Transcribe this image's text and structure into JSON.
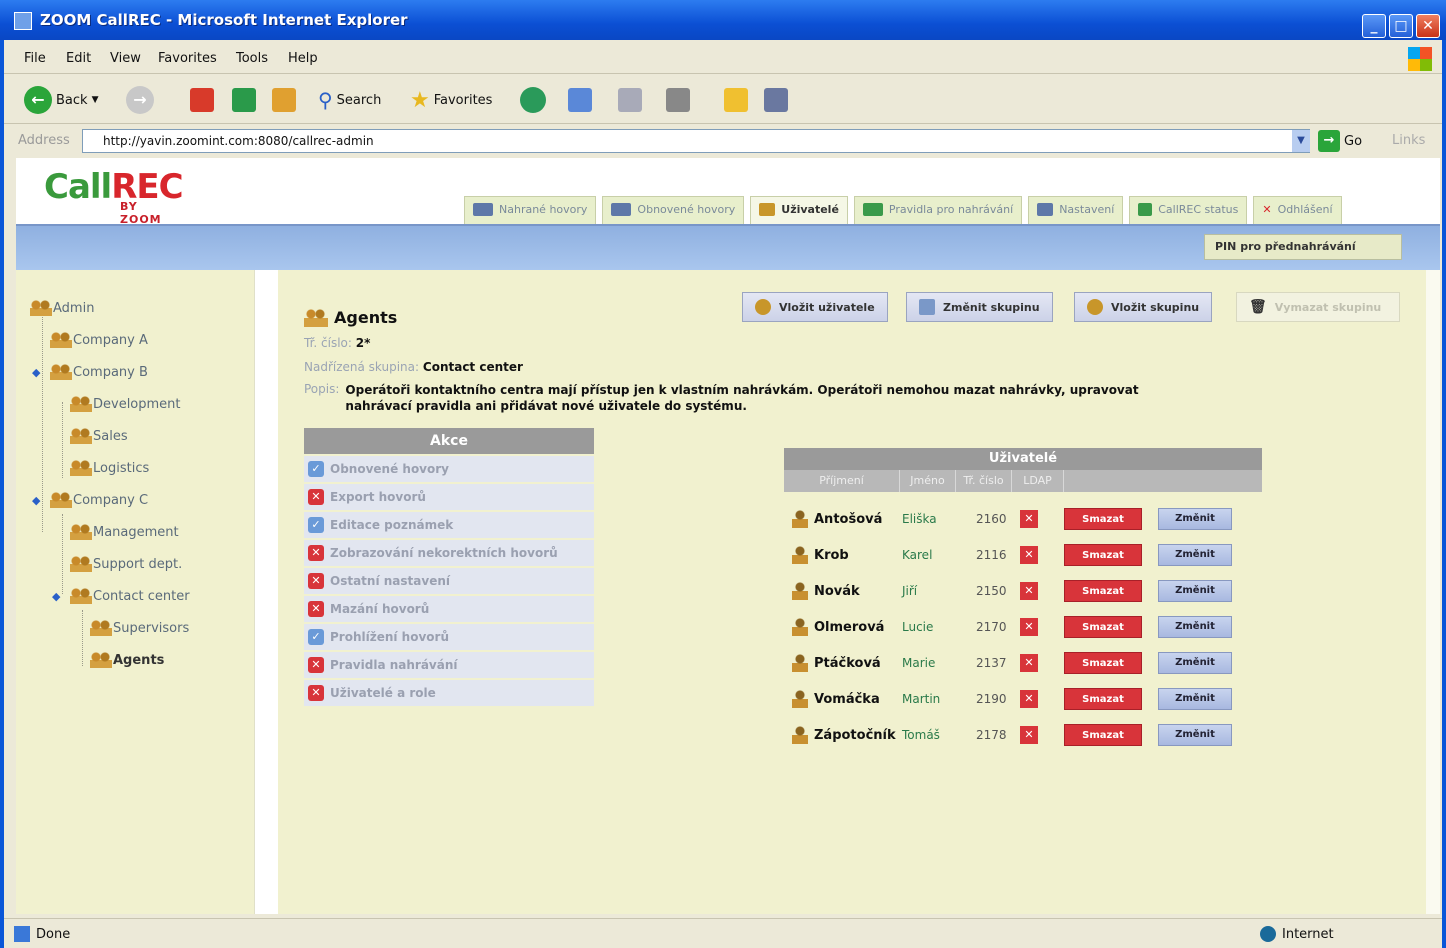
{
  "window": {
    "title": "ZOOM CallREC - Microsoft Internet Explorer"
  },
  "menu": [
    "File",
    "Edit",
    "View",
    "Favorites",
    "Tools",
    "Help"
  ],
  "toolbar": {
    "back": "Back",
    "search": "Search",
    "favorites": "Favorites"
  },
  "address": {
    "label": "Address",
    "url": "http://yavin.zoomint.com:8080/callrec-admin",
    "go": "Go",
    "links": "Links"
  },
  "logo": {
    "main_a": "Call",
    "main_b": "REC",
    "sub": "BY ZOOM"
  },
  "tabs": [
    "Nahrané hovory",
    "Obnovené hovory",
    "Uživatelé",
    "Pravidla pro nahrávání",
    "Nastavení",
    "CallREC status",
    "Odhlášení"
  ],
  "pin_button": "PIN pro přednahrávání",
  "tree": {
    "root": "Admin",
    "company_a": "Company A",
    "company_b": "Company B",
    "development": "Development",
    "sales": "Sales",
    "logistics": "Logistics",
    "company_c": "Company C",
    "management": "Management",
    "support": "Support dept.",
    "contact_center": "Contact center",
    "supervisors": "Supervisors",
    "agents": "Agents"
  },
  "actions": {
    "insert_user": "Vložit uživatele",
    "change_group": "Změnit skupinu",
    "insert_group": "Vložit skupinu",
    "delete_group": "Vymazat skupinu"
  },
  "group": {
    "name": "Agents",
    "ext_label": "Tř. číslo:",
    "ext_value": "2*",
    "parent_label": "Nadřízená skupina:",
    "parent_value": "Contact center",
    "desc_label": "Popis:",
    "desc_value": "Operátoři kontaktního centra mají přístup jen k vlastním nahrávkám. Operátoři nemohou mazat nahrávky, upravovat nahrávací pravidla ani přidávat nové uživatele do systému."
  },
  "akce": {
    "header": "Akce",
    "rows": [
      {
        "label": "Obnovené hovory",
        "on": true
      },
      {
        "label": "Export hovorů",
        "on": false
      },
      {
        "label": "Editace poznámek",
        "on": true
      },
      {
        "label": "Zobrazování nekorektních hovorů",
        "on": false
      },
      {
        "label": "Ostatní nastavení",
        "on": false
      },
      {
        "label": "Mazání hovorů",
        "on": false
      },
      {
        "label": "Prohlížení hovorů",
        "on": true
      },
      {
        "label": "Pravidla nahrávání",
        "on": false
      },
      {
        "label": "Uživatelé a role",
        "on": false
      }
    ]
  },
  "users": {
    "header": "Uživatelé",
    "columns": [
      "Příjmení",
      "Jméno",
      "Tř. číslo",
      "LDAP"
    ],
    "delete_label": "Smazat",
    "edit_label": "Změnit",
    "rows": [
      {
        "last": "Antošová",
        "first": "Eliška",
        "ext": "2160"
      },
      {
        "last": "Krob",
        "first": "Karel",
        "ext": "2116"
      },
      {
        "last": "Novák",
        "first": "Jiří",
        "ext": "2150"
      },
      {
        "last": "Olmerová",
        "first": "Lucie",
        "ext": "2170"
      },
      {
        "last": "Ptáčková",
        "first": "Marie",
        "ext": "2137"
      },
      {
        "last": "Vomáčka",
        "first": "Martin",
        "ext": "2190"
      },
      {
        "last": "Zápotočník",
        "first": "Tomáš",
        "ext": "2178"
      }
    ]
  },
  "status": {
    "left": "Done",
    "right": "Internet"
  }
}
